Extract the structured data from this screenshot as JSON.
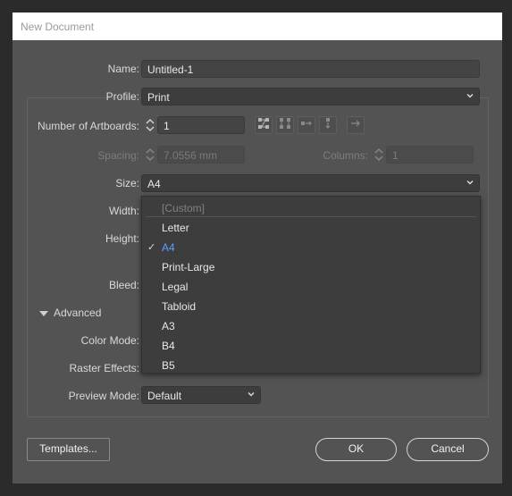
{
  "window": {
    "title": "New Document"
  },
  "form": {
    "name_label": "Name:",
    "name_value": "Untitled-1",
    "profile_label": "Profile:",
    "profile_value": "Print",
    "artboards_label": "Number of Artboards:",
    "artboards_value": "1",
    "spacing_label": "Spacing:",
    "spacing_value": "7.0556 mm",
    "columns_label": "Columns:",
    "columns_value": "1",
    "size_label": "Size:",
    "size_value": "A4",
    "width_label": "Width:",
    "height_label": "Height:",
    "bleed_label": "Bleed:",
    "advanced_label": "Advanced",
    "color_mode_label": "Color Mode:",
    "raster_effects_label": "Raster Effects:",
    "preview_mode_label": "Preview Mode:",
    "preview_mode_value": "Default"
  },
  "size_dropdown": {
    "custom": "[Custom]",
    "items": [
      "Letter",
      "A4",
      "Print-Large",
      "Legal",
      "Tabloid",
      "A3",
      "B4",
      "B5"
    ],
    "selected": "A4"
  },
  "buttons": {
    "templates": "Templates...",
    "ok": "OK",
    "cancel": "Cancel"
  },
  "colors": {
    "selected_item": "#5aa0ff",
    "dialog_bg": "#535353"
  },
  "icons": [
    "grid-by-row-icon",
    "grid-by-column-icon",
    "arrange-by-row-icon",
    "arrange-by-column-icon",
    "right-to-left-icon",
    "chevron-down-icon",
    "stepper-icon",
    "checkmark-icon",
    "disclosure-triangle-icon"
  ]
}
